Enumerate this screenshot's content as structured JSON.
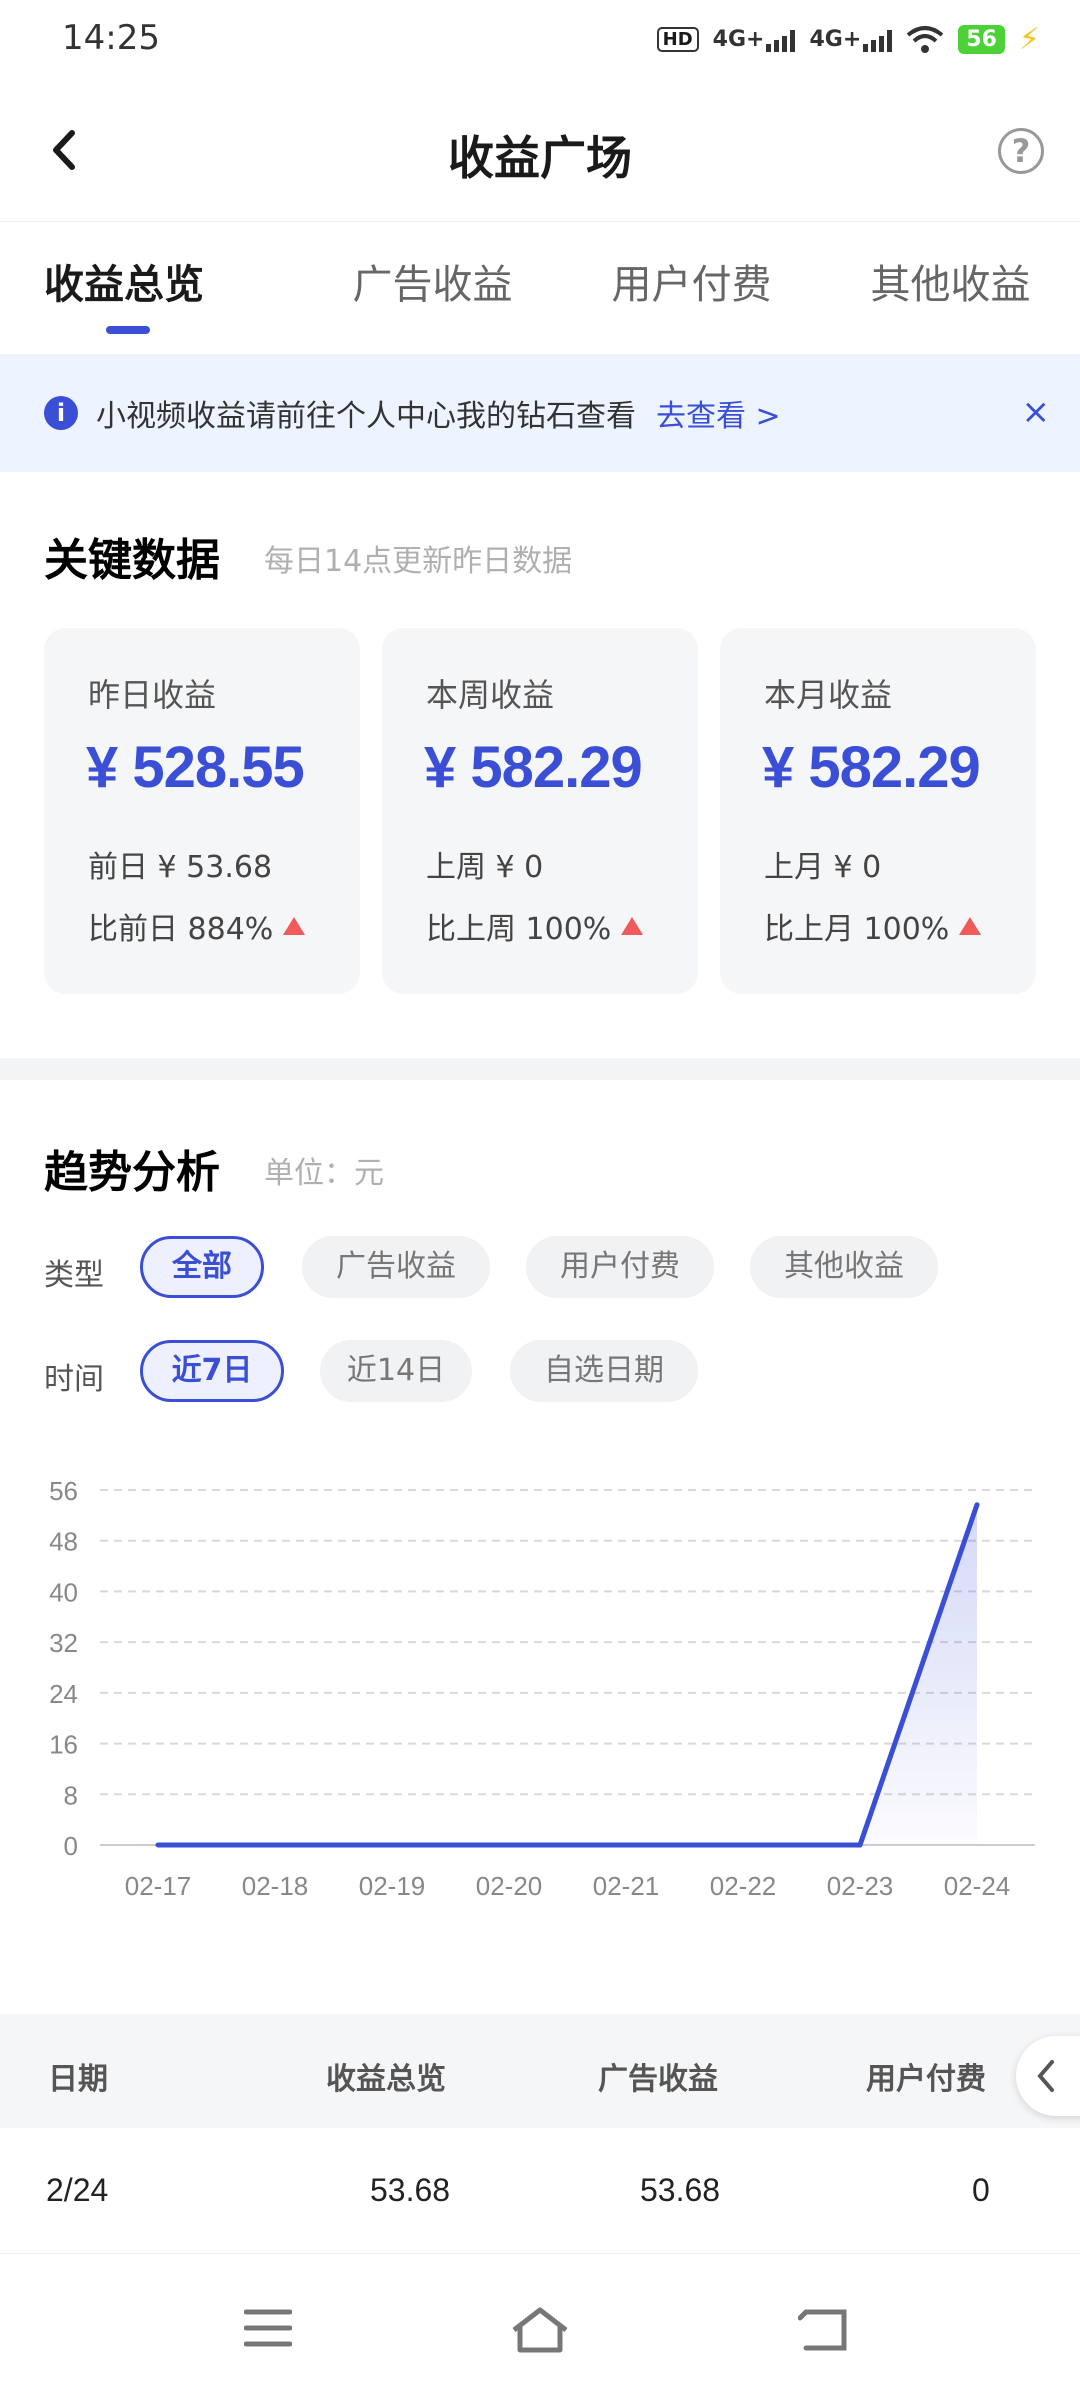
{
  "status_bar": {
    "time": "14:25",
    "hd": "HD",
    "net1": "4G+",
    "net2": "4G+",
    "battery": "56"
  },
  "nav": {
    "title": "收益广场"
  },
  "tabs": [
    {
      "label": "收益总览",
      "active": true
    },
    {
      "label": "广告收益",
      "active": false
    },
    {
      "label": "用户付费",
      "active": false
    },
    {
      "label": "其他收益",
      "active": false
    }
  ],
  "notice": {
    "text": "小视频收益请前往个人中心我的钻石查看",
    "link": "去查看 >"
  },
  "key_data": {
    "title": "关键数据",
    "subtitle": "每日14点更新昨日数据",
    "cards": [
      {
        "label": "昨日收益",
        "value": "¥ 528.55",
        "prev": "前日 ¥ 53.68",
        "cmp": "比前日 884%"
      },
      {
        "label": "本周收益",
        "value": "¥ 582.29",
        "prev": "上周 ¥ 0",
        "cmp": "比上周 100%"
      },
      {
        "label": "本月收益",
        "value": "¥ 582.29",
        "prev": "上月 ¥ 0",
        "cmp": "比上月 100%"
      }
    ]
  },
  "trend": {
    "title": "趋势分析",
    "unit": "单位：元",
    "type_label": "类型",
    "type_options": [
      "全部",
      "广告收益",
      "用户付费",
      "其他收益"
    ],
    "time_label": "时间",
    "time_options": [
      "近7日",
      "近14日",
      "自选日期"
    ],
    "colors": {
      "accent": "#3a4fd6"
    }
  },
  "chart_data": {
    "type": "area",
    "x": [
      "02-17",
      "02-18",
      "02-19",
      "02-20",
      "02-21",
      "02-22",
      "02-23",
      "02-24"
    ],
    "y_ticks": [
      0,
      8,
      16,
      24,
      32,
      40,
      48,
      56
    ],
    "ylim": [
      0,
      56
    ],
    "values": [
      0,
      0,
      0,
      0,
      0,
      0,
      0,
      53.68
    ],
    "grid": true
  },
  "table": {
    "headers": [
      "日期",
      "收益总览",
      "广告收益",
      "用户付费"
    ],
    "rows": [
      [
        "2/24",
        "53.68",
        "53.68",
        "0"
      ]
    ]
  }
}
